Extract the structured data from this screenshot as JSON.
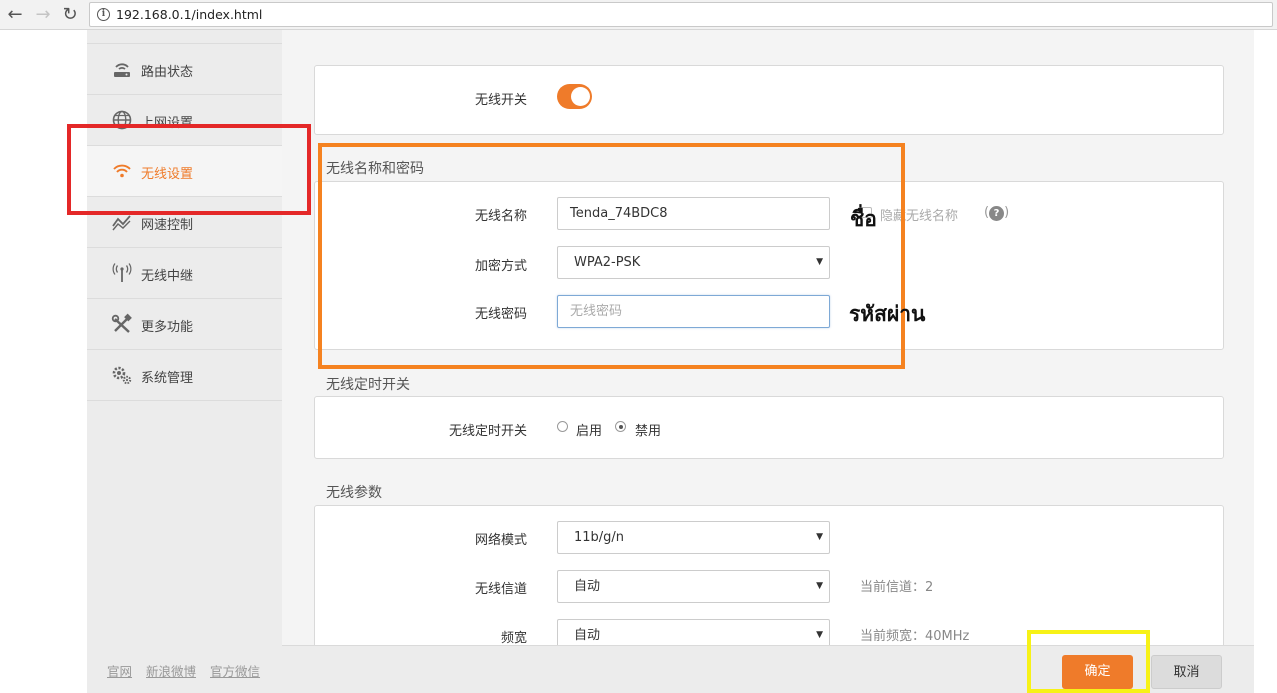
{
  "browser": {
    "url": "192.168.0.1/index.html",
    "back_icon": "arrow-left-icon",
    "forward_icon": "arrow-right-icon",
    "reload_icon": "reload-icon",
    "info_icon": "info-icon",
    "info_glyph": "i"
  },
  "sidebar": {
    "items": [
      {
        "label": "路由状态",
        "icon": "router-icon"
      },
      {
        "label": "上网设置",
        "icon": "globe-icon"
      },
      {
        "label": "无线设置",
        "icon": "wifi-icon",
        "active": true
      },
      {
        "label": "网速控制",
        "icon": "speed-icon"
      },
      {
        "label": "无线中继",
        "icon": "antenna-icon"
      },
      {
        "label": "更多功能",
        "icon": "tools-icon"
      },
      {
        "label": "系统管理",
        "icon": "gear-icon"
      }
    ],
    "footer_links": [
      "官网",
      "新浪微博",
      "官方微信"
    ]
  },
  "wireless": {
    "switch_label": "无线开关",
    "switch_on": true,
    "name_password_section": "无线名称和密码",
    "ssid_label": "无线名称",
    "ssid_value": "Tenda_74BDC8",
    "hide_ssid_label": "隐藏无线名称",
    "help_glyph": "?",
    "encryption_label": "加密方式",
    "encryption_value": "WPA2-PSK",
    "password_label": "无线密码",
    "password_placeholder": "无线密码",
    "schedule_section": "无线定时开关",
    "schedule_label": "无线定时开关",
    "schedule_options": [
      "启用",
      "禁用"
    ],
    "schedule_selected": "禁用",
    "params_section": "无线参数",
    "mode_label": "网络模式",
    "mode_value": "11b/g/n",
    "channel_label": "无线信道",
    "channel_value": "自动",
    "channel_hint": "当前信道：2",
    "bandwidth_label": "频宽",
    "bandwidth_value": "自动",
    "bandwidth_hint": "当前频宽：40MHz"
  },
  "buttons": {
    "ok": "确定",
    "cancel": "取消"
  },
  "annotations": {
    "name_th": "ชื่อ",
    "password_th": "รหัสผ่าน"
  },
  "colors": {
    "accent": "#ef7b2a",
    "box_red": "#e42828",
    "box_orange": "#f58220",
    "box_yellow": "#f7f217"
  }
}
